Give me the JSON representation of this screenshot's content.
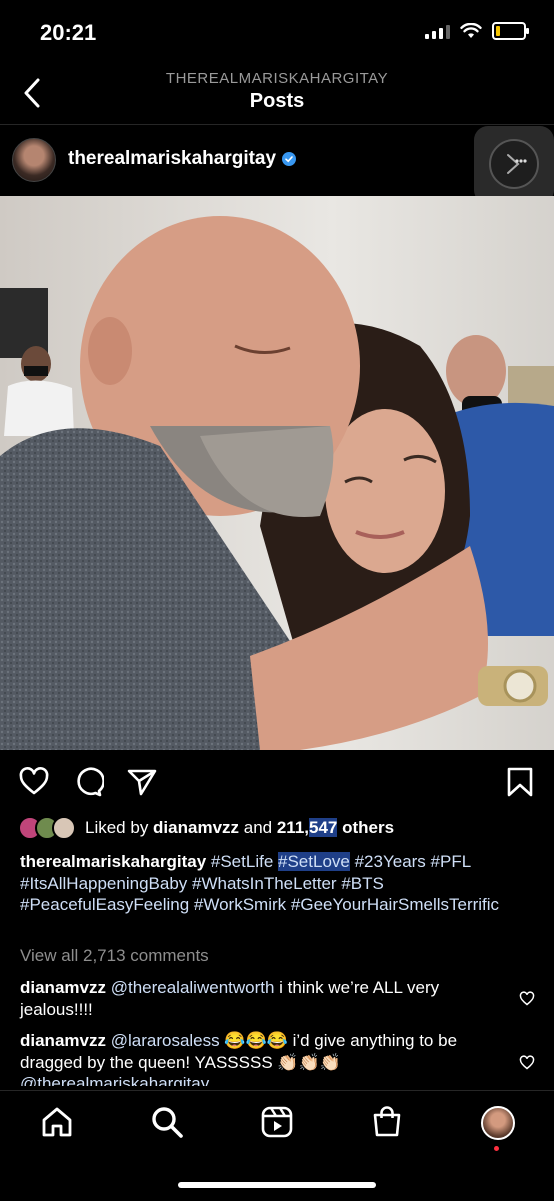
{
  "status_bar": {
    "time": "20:21"
  },
  "header": {
    "subtitle": "THEREALMARISKAHARGITAY",
    "title": "Posts"
  },
  "post": {
    "username": "therealmariskahargitay",
    "likes": {
      "prefix": "Liked by ",
      "user": "dianamvzz",
      "and": " and ",
      "count_a": "211,",
      "count_b": "547",
      "suffix": " others"
    },
    "caption": {
      "user": "therealmariskahargitay",
      "tags": [
        "#SetLife",
        "#SetLove",
        "#23Years",
        "#PFL",
        "#ItsAllHappeningBaby",
        "#WhatsInTheLetter",
        "#BTS",
        "#PeacefulEasyFeeling",
        "#WorkSmirk",
        "#GeeYourHairSmellsTerrific"
      ]
    },
    "view_all": "View all 2,713 comments",
    "comments": [
      {
        "user": "dianamvzz",
        "mention": "@therealaliwentworth",
        "text": " i think we’re ALL very jealous!!!!"
      },
      {
        "user": "dianamvzz",
        "mention": "@lararosaless",
        "text": " 😂😂😂 i’d give anything to be dragged by the queen! YASSSSS 👏🏻👏🏻👏🏻",
        "tail_mention": "@therealmariskahargitay"
      }
    ]
  },
  "icons": [
    "back-icon",
    "more-icon",
    "heart-icon",
    "comment-icon",
    "share-icon",
    "bookmark-icon",
    "home-icon",
    "search-icon",
    "reels-icon",
    "shop-icon"
  ],
  "colors": {
    "background": "#000000",
    "verified": "#3897f0",
    "hashtag": "#cfdff7",
    "muted": "#8e8e8e",
    "selection": "#1f3f88"
  }
}
